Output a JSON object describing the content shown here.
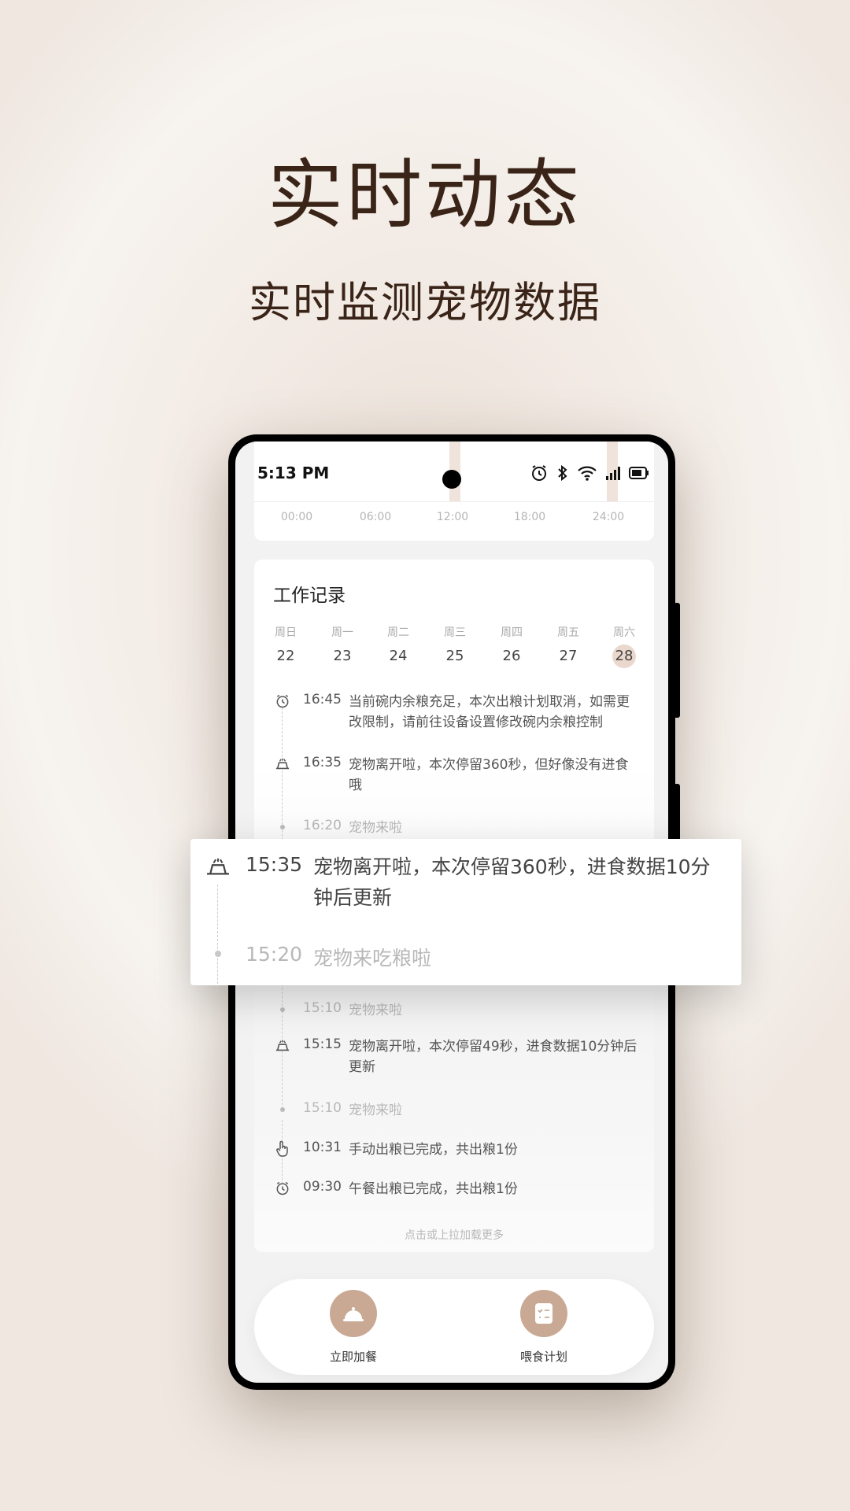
{
  "hero": {
    "title": "实时动态",
    "subtitle": "实时监测宠物数据"
  },
  "status_bar": {
    "time": "5:13 PM",
    "icons": [
      "alarm-icon",
      "bluetooth-icon",
      "wifi-icon",
      "signal-icon",
      "battery-icon"
    ]
  },
  "timeline_axis": {
    "labels": [
      "00:00",
      "06:00",
      "12:00",
      "18:00",
      "24:00"
    ]
  },
  "work_record": {
    "title": "工作记录",
    "week": [
      {
        "name": "周日",
        "date": "22"
      },
      {
        "name": "周一",
        "date": "23"
      },
      {
        "name": "周二",
        "date": "24"
      },
      {
        "name": "周三",
        "date": "25"
      },
      {
        "name": "周四",
        "date": "26"
      },
      {
        "name": "周五",
        "date": "27"
      },
      {
        "name": "周六",
        "date": "28",
        "selected": true
      }
    ],
    "events": [
      {
        "icon": "alarm-icon",
        "time": "16:45",
        "text": "当前碗内余粮充足，本次出粮计划取消，如需更改限制，请前往设备设置修改碗内余粮控制",
        "muted": false
      },
      {
        "icon": "bowl-icon",
        "time": "16:35",
        "text": "宠物离开啦，本次停留360秒，但好像没有进食哦",
        "muted": false
      },
      {
        "icon": "dot",
        "time": "16:20",
        "text": "宠物来啦",
        "muted": true
      },
      {
        "icon": "dot",
        "time": "15:10",
        "text": "宠物来啦",
        "muted": true
      },
      {
        "icon": "bowl-icon",
        "time": "15:15",
        "text": "宠物离开啦，本次停留49秒，进食数据10分钟后更新",
        "muted": false
      },
      {
        "icon": "dot",
        "time": "15:10",
        "text": "宠物来啦",
        "muted": true
      },
      {
        "icon": "hand-tap-icon",
        "time": "10:31",
        "text": "手动出粮已完成，共出粮1份",
        "muted": false
      },
      {
        "icon": "alarm-icon",
        "time": "09:30",
        "text": "午餐出粮已完成，共出粮1份",
        "muted": false
      }
    ],
    "load_more": "点击或上拉加载更多"
  },
  "bottom_bar": {
    "feed_now": "立即加餐",
    "feed_plan": "喂食计划"
  },
  "popup": {
    "event1": {
      "time": "15:35",
      "text": "宠物离开啦，本次停留360秒，进食数据10分钟后更新"
    },
    "event2": {
      "time": "15:20",
      "text": "宠物来吃粮啦"
    }
  },
  "colors": {
    "accent": "#c9a994",
    "selected_day_bg": "#ead8cd",
    "title_text": "#3a2418"
  }
}
